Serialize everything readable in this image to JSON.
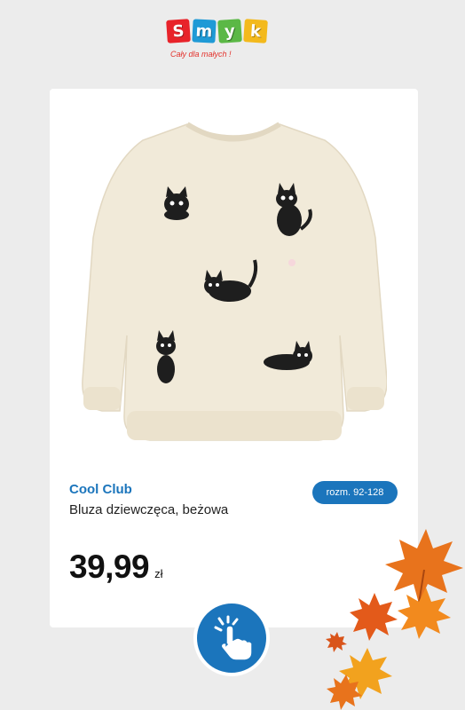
{
  "logo": {
    "letters": [
      "S",
      "m",
      "y",
      "k"
    ],
    "tile_colors": [
      "#e8232a",
      "#1f9ad6",
      "#5bb846",
      "#f3b91c"
    ],
    "tagline": "Cały dla małych !"
  },
  "product": {
    "brand": "Cool Club",
    "name": "Bluza dziewczęca, beżowa",
    "size_badge": "rozm. 92-128",
    "price": "39,99",
    "currency": "zł",
    "image_icon": "sweatshirt-with-cats-image"
  },
  "cta": {
    "icon": "tap-hand-icon"
  },
  "colors": {
    "accent": "#1b75bc",
    "background": "#ececec",
    "card": "#ffffff",
    "leaf_orange": "#e8731c"
  }
}
